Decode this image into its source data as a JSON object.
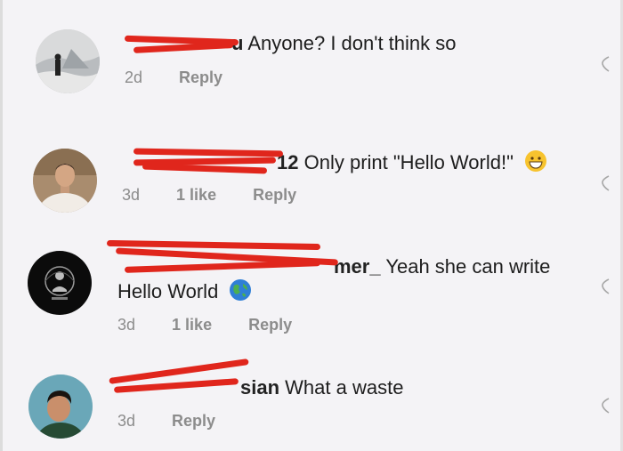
{
  "comments": [
    {
      "username_fragment": "u",
      "text": "Anyone? I don't think so",
      "time": "2d",
      "likes": "",
      "reply": "Reply",
      "avatar_icon": "landscape-person-avatar-icon"
    },
    {
      "username_fragment": "12",
      "text": "Only print \"Hello World!\"",
      "emoji": "grinning-face-emoji-icon",
      "time": "3d",
      "likes": "1 like",
      "reply": "Reply",
      "avatar_icon": "man-portrait-avatar-icon"
    },
    {
      "username_fragment": "mer_",
      "text": "Yeah she can write",
      "text_line2": "Hello World",
      "emoji": "globe-emoji-icon",
      "time": "3d",
      "likes": "1 like",
      "reply": "Reply",
      "avatar_icon": "anonymous-logo-avatar-icon"
    },
    {
      "username_fragment": "sian",
      "text": "What a waste",
      "time": "3d",
      "likes": "",
      "reply": "Reply",
      "avatar_icon": "young-man-portrait-avatar-icon"
    }
  ],
  "colors": {
    "redaction": "#e0261c",
    "meta": "#8c8c8c",
    "background": "#f4f3f6"
  }
}
